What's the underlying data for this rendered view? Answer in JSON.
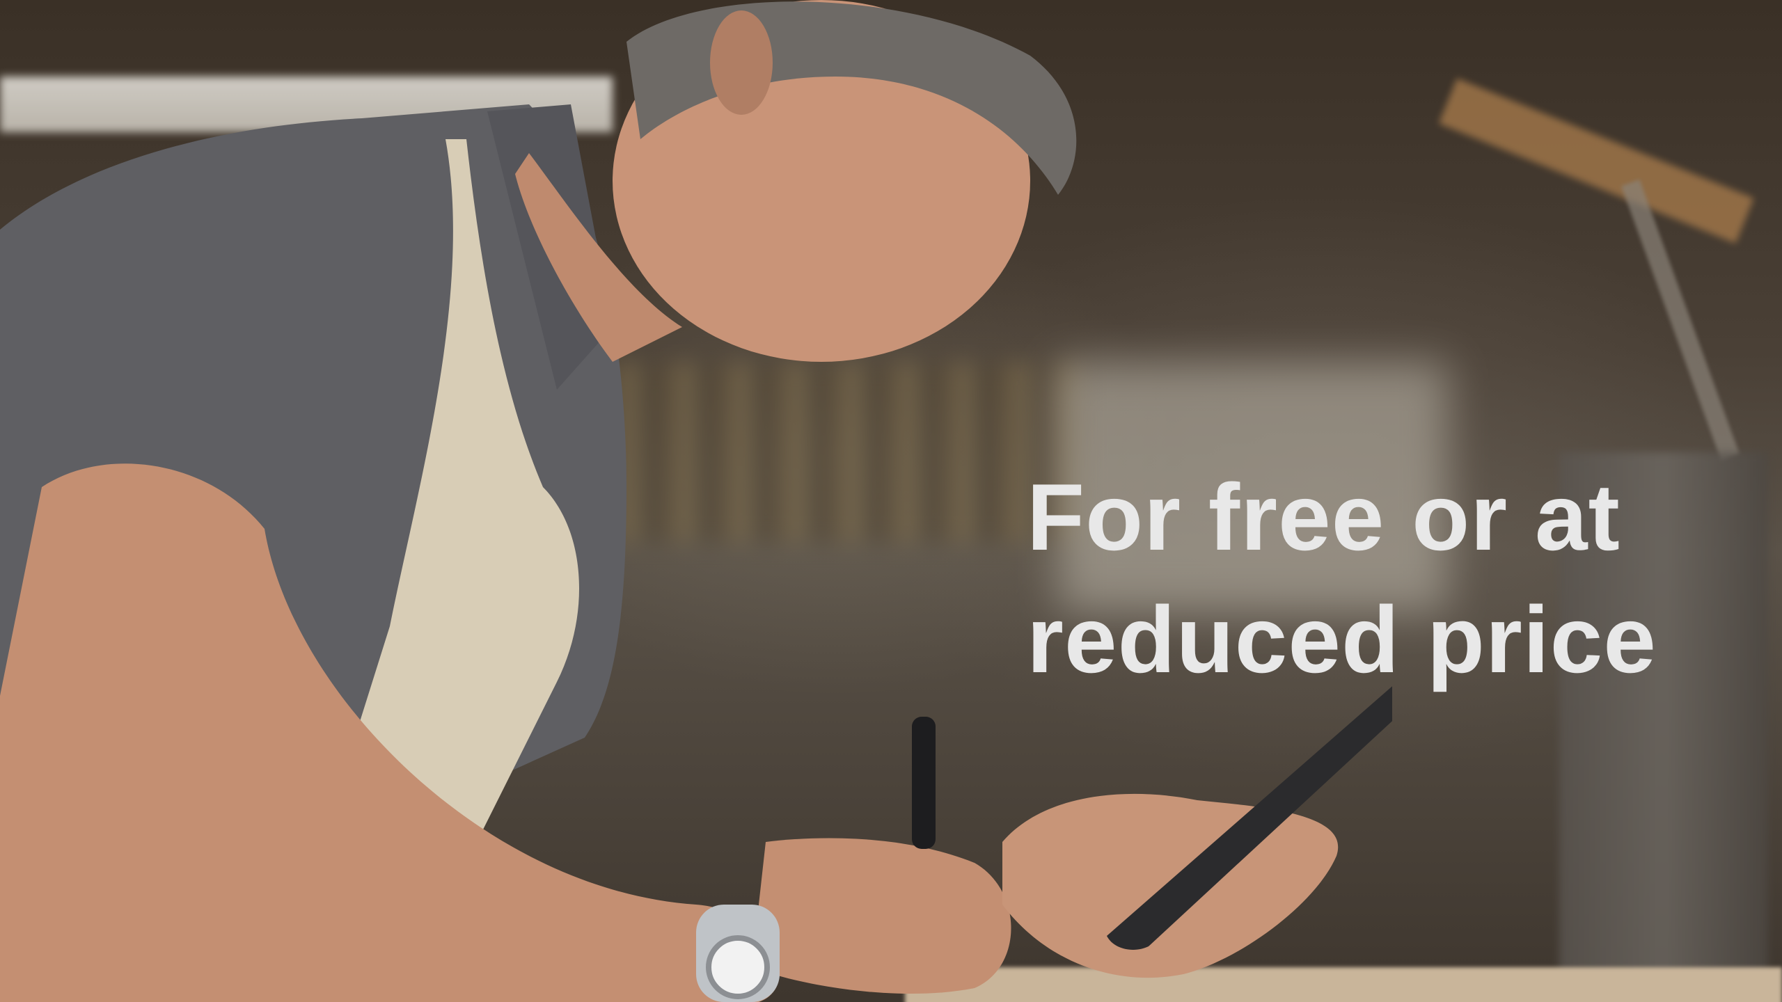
{
  "headline": {
    "line1": "For free or at",
    "line2": "reduced price"
  },
  "photo": {
    "scene": "woodworking-workshop",
    "colors": {
      "text": "#e8e8e8",
      "shirt": "#5f5f63",
      "apron": "#d8cdb6",
      "skin": "#c48f72",
      "tablet": "#2b2b2d"
    }
  }
}
